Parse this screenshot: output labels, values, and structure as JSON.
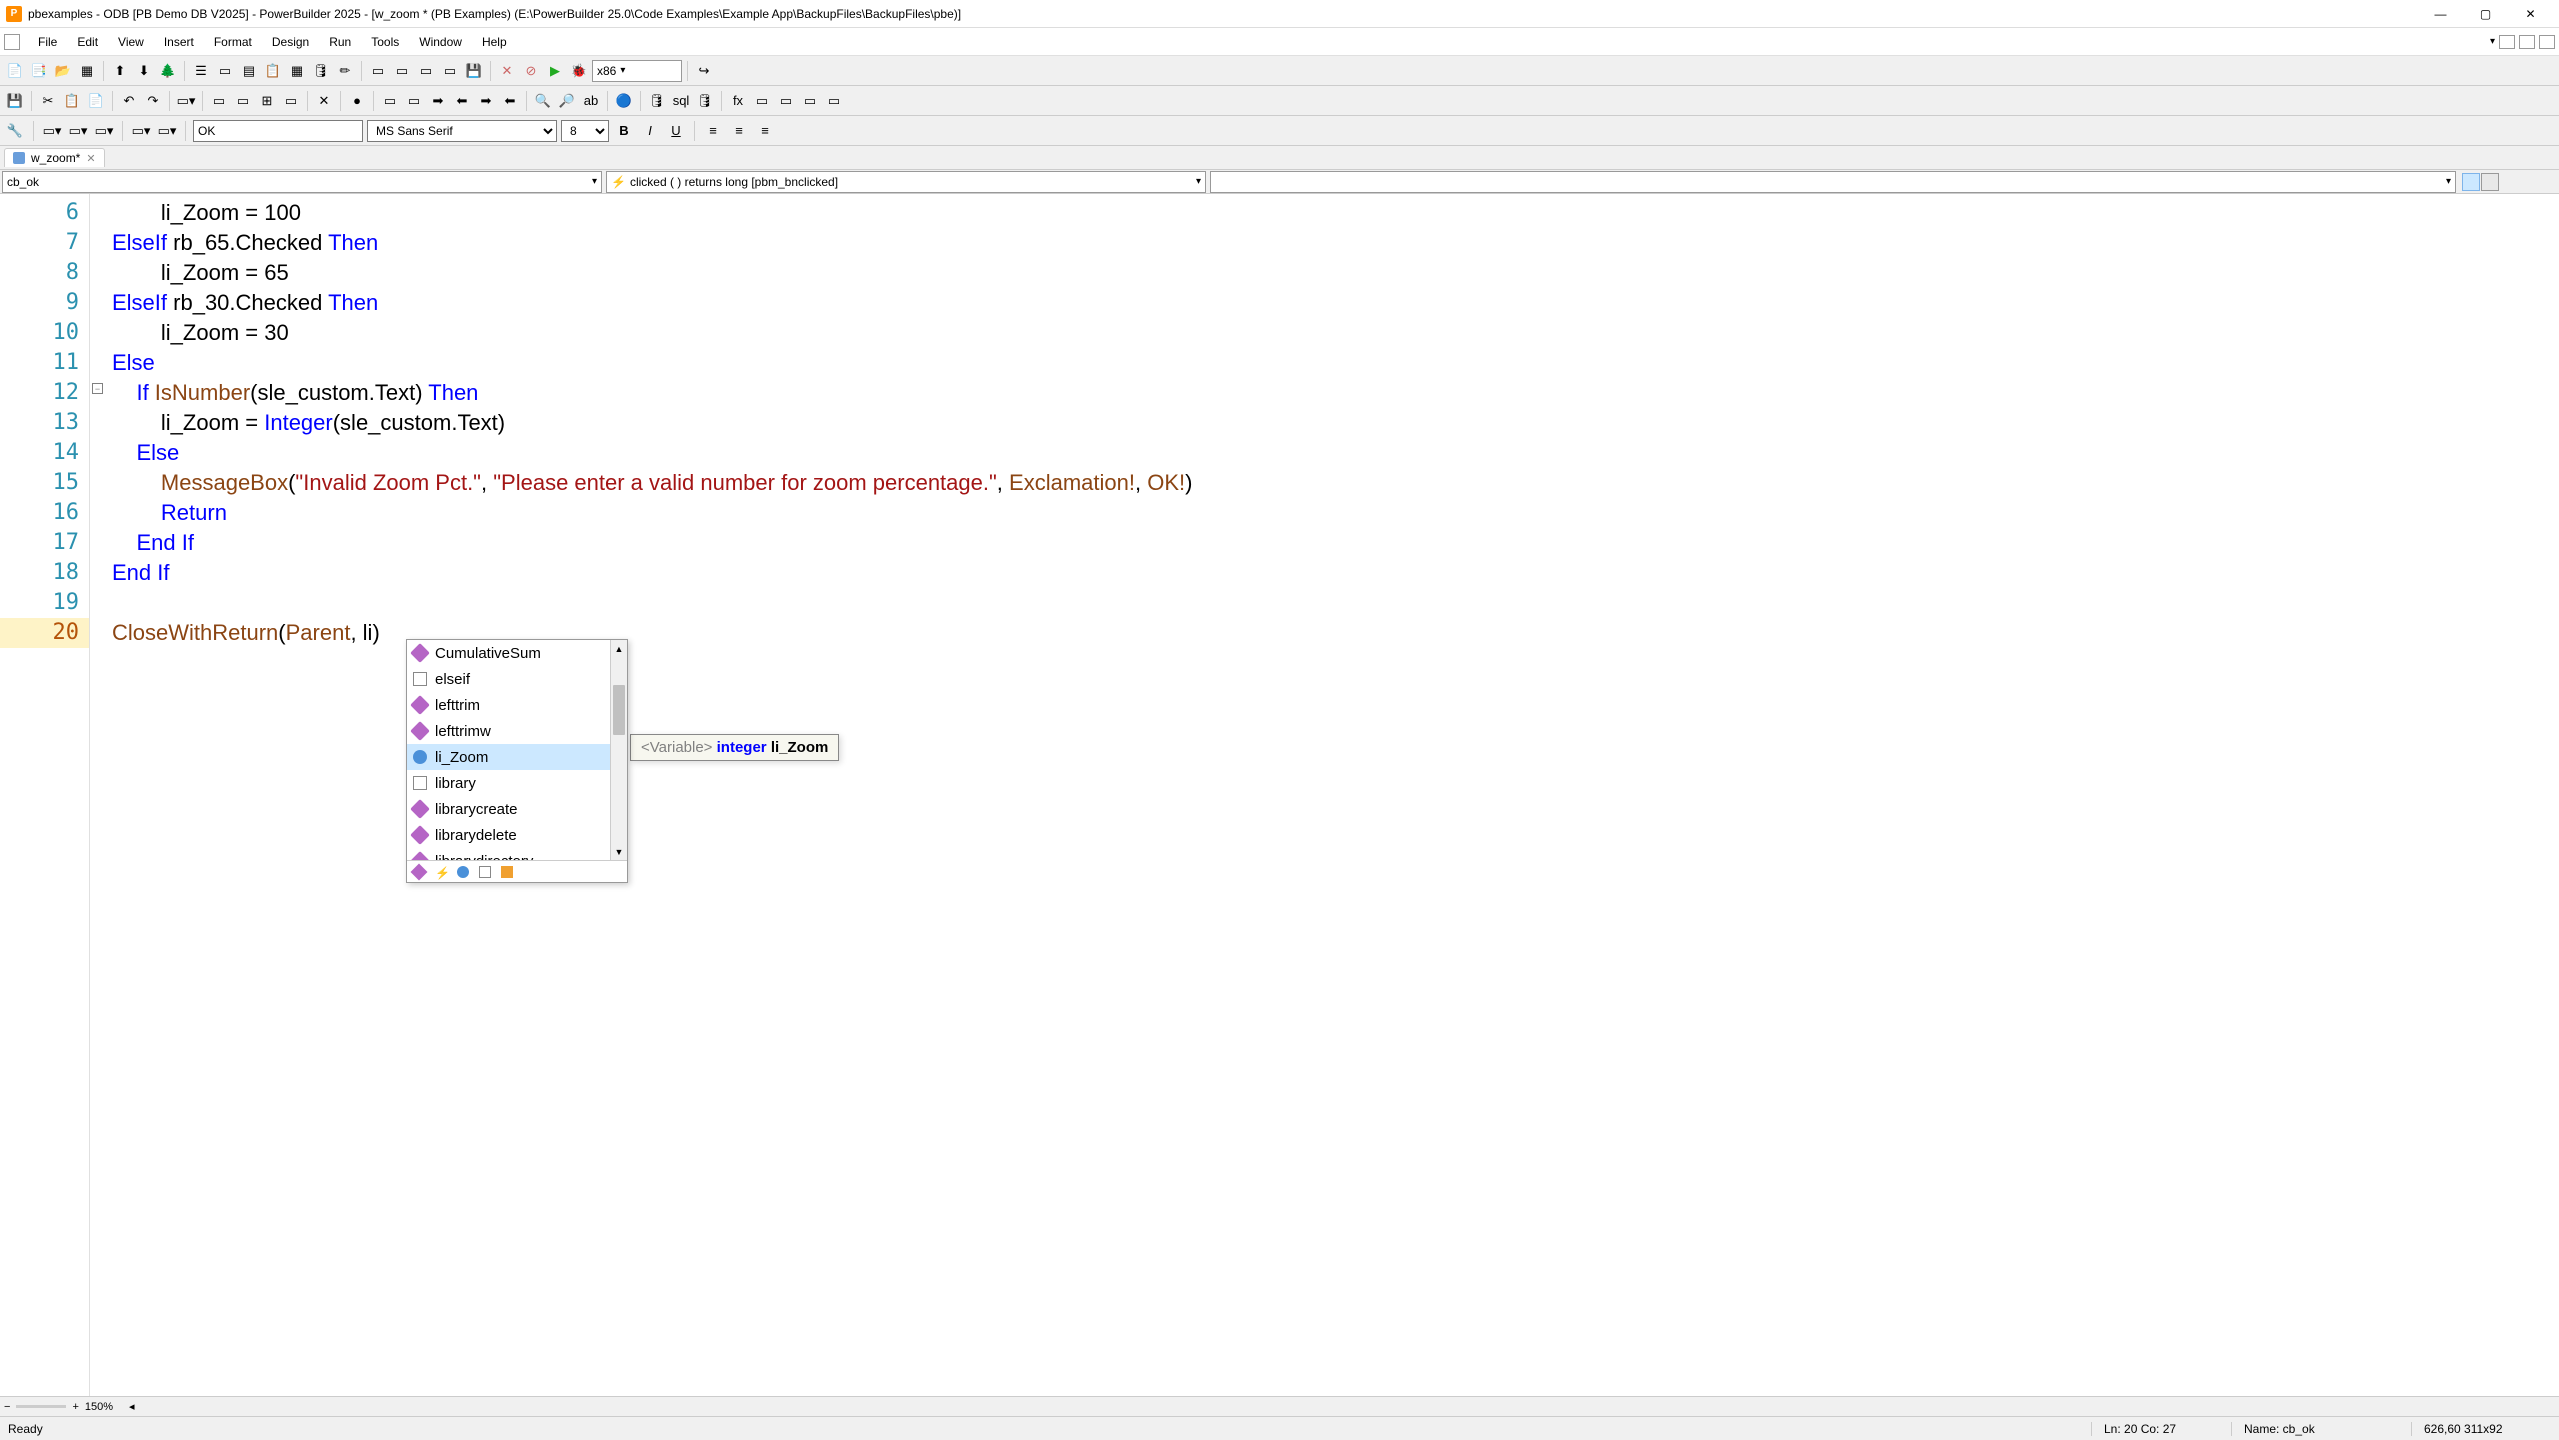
{
  "window": {
    "title": "pbexamples - ODB [PB Demo DB V2025] - PowerBuilder 2025 - [w_zoom * (PB Examples) (E:\\PowerBuilder 25.0\\Code Examples\\Example App\\BackupFiles\\BackupFiles\\pbe)]"
  },
  "menu": {
    "items": [
      "File",
      "Edit",
      "View",
      "Insert",
      "Format",
      "Design",
      "Run",
      "Tools",
      "Window",
      "Help"
    ]
  },
  "toolbar1": {
    "platform": "x86"
  },
  "formatbar": {
    "object_text": "OK",
    "font_name": "MS Sans Serif",
    "font_size": "8"
  },
  "tab": {
    "name": "w_zoom*"
  },
  "controlbar": {
    "control": "cb_ok",
    "event": "clicked ( )  returns long [pbm_bnclicked]"
  },
  "code": {
    "lines": [
      {
        "n": 6,
        "indent": 2,
        "tokens": [
          [
            "txt",
            "li_Zoom = 100"
          ]
        ]
      },
      {
        "n": 7,
        "indent": 0,
        "tokens": [
          [
            "kw",
            "ElseIf "
          ],
          [
            "txt",
            "rb_65.Checked "
          ],
          [
            "kw",
            "Then"
          ]
        ]
      },
      {
        "n": 8,
        "indent": 2,
        "tokens": [
          [
            "txt",
            "li_Zoom = 65"
          ]
        ]
      },
      {
        "n": 9,
        "indent": 0,
        "tokens": [
          [
            "kw",
            "ElseIf "
          ],
          [
            "txt",
            "rb_30.Checked "
          ],
          [
            "kw",
            "Then"
          ]
        ]
      },
      {
        "n": 10,
        "indent": 2,
        "tokens": [
          [
            "txt",
            "li_Zoom = 30"
          ]
        ]
      },
      {
        "n": 11,
        "indent": 0,
        "tokens": [
          [
            "kw",
            "Else"
          ]
        ]
      },
      {
        "n": 12,
        "indent": 1,
        "tokens": [
          [
            "kw",
            "If "
          ],
          [
            "fn",
            "IsNumber"
          ],
          [
            "txt",
            "(sle_custom.Text) "
          ],
          [
            "kw",
            "Then"
          ]
        ],
        "fold": true
      },
      {
        "n": 13,
        "indent": 2,
        "tokens": [
          [
            "txt",
            "li_Zoom = "
          ],
          [
            "ty",
            "Integer"
          ],
          [
            "txt",
            "(sle_custom.Text)"
          ]
        ]
      },
      {
        "n": 14,
        "indent": 1,
        "tokens": [
          [
            "kw",
            "Else"
          ]
        ]
      },
      {
        "n": 15,
        "indent": 2,
        "tokens": [
          [
            "fn",
            "MessageBox"
          ],
          [
            "txt",
            "("
          ],
          [
            "str",
            "\"Invalid Zoom Pct.\""
          ],
          [
            "txt",
            ", "
          ],
          [
            "str",
            "\"Please enter a valid number for zoom percentage.\""
          ],
          [
            "txt",
            ", "
          ],
          [
            "enm",
            "Exclamation!"
          ],
          [
            "txt",
            ", "
          ],
          [
            "enm",
            "OK!"
          ],
          [
            "txt",
            ")"
          ]
        ]
      },
      {
        "n": 16,
        "indent": 2,
        "tokens": [
          [
            "kw",
            "Return"
          ]
        ]
      },
      {
        "n": 17,
        "indent": 1,
        "tokens": [
          [
            "kw",
            "End If"
          ]
        ]
      },
      {
        "n": 18,
        "indent": 0,
        "tokens": [
          [
            "kw",
            "End If"
          ]
        ]
      },
      {
        "n": 19,
        "indent": 0,
        "tokens": [
          [
            "txt",
            ""
          ]
        ]
      },
      {
        "n": 20,
        "indent": 0,
        "tokens": [
          [
            "fn",
            "CloseWithReturn"
          ],
          [
            "txt",
            "("
          ],
          [
            "enm",
            "Parent"
          ],
          [
            "txt",
            ", li"
          ],
          [
            "txt",
            ")"
          ]
        ],
        "current": true
      }
    ]
  },
  "autocomplete": {
    "items": [
      {
        "icon": "method",
        "label": "CumulativeSum"
      },
      {
        "icon": "keyword",
        "label": "elseif"
      },
      {
        "icon": "method",
        "label": "lefttrim"
      },
      {
        "icon": "method",
        "label": "lefttrimw"
      },
      {
        "icon": "variable",
        "label": "li_Zoom",
        "selected": true
      },
      {
        "icon": "keyword",
        "label": "library"
      },
      {
        "icon": "method",
        "label": "librarycreate"
      },
      {
        "icon": "method",
        "label": "librarydelete"
      },
      {
        "icon": "method",
        "label": "librarydirectory"
      }
    ]
  },
  "tooltip": {
    "tag": "<Variable>",
    "type": "integer",
    "name": "li_Zoom"
  },
  "zoom": {
    "percent": "150%"
  },
  "status": {
    "ready": "Ready",
    "name": "Name: cb_ok",
    "coords": "626,60 311x92",
    "linecol": "Ln: 20    Co: 27"
  }
}
